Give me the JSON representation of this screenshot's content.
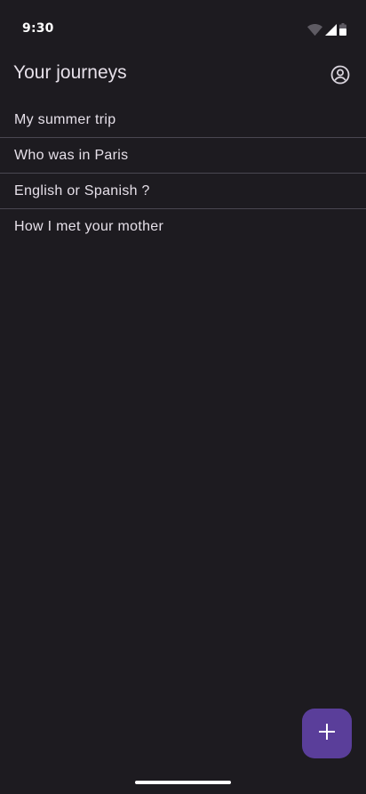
{
  "status_bar": {
    "time": "9:30",
    "icons": [
      "wifi-icon",
      "signal-icon",
      "battery-icon"
    ]
  },
  "app_bar": {
    "title": "Your journeys",
    "profile_icon": "account-circle-icon"
  },
  "journeys": [
    {
      "title": "My summer trip"
    },
    {
      "title": "Who was in Paris"
    },
    {
      "title": "English or Spanish ?"
    },
    {
      "title": "How I met your mother"
    }
  ],
  "fab": {
    "icon": "add-icon",
    "color": "#5a3e9a"
  },
  "colors": {
    "background": "#1d1b20",
    "text": "#e6e0e9",
    "divider": "#4a4751",
    "accent": "#5a3e9a"
  }
}
